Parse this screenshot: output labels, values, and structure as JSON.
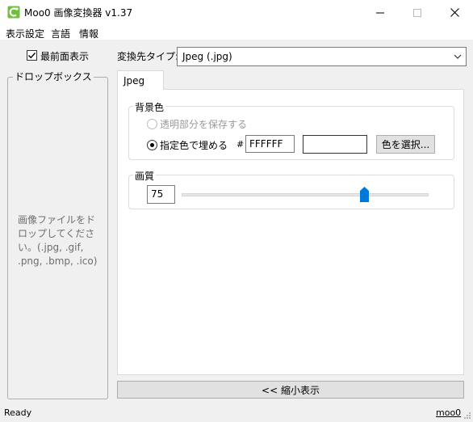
{
  "window": {
    "title": "Moo0 画像変換器 v1.37",
    "accent_color": "#6fbf3c"
  },
  "menu": {
    "items": [
      "表示設定",
      "言語",
      "情報"
    ]
  },
  "left_panel": {
    "always_on_top_label": "最前面表示",
    "always_on_top_checked": true,
    "dropbox_title": "ドロップボックス",
    "dropbox_hint": "画像ファイルをドロップしてください。(.jpg, .gif, .png, .bmp, .ico)"
  },
  "main": {
    "target_type_label": "変換先タイプ:",
    "target_type_value": "Jpeg (.jpg)",
    "tab_label": "Jpeg",
    "background": {
      "title": "背景色",
      "option_keep_transparent": "透明部分を保存する",
      "option_fill_color": "指定色で埋める",
      "hash_label": "#",
      "color_hex_value": "FFFFFF",
      "swatch_color": "#ffffff",
      "choose_color_button": "色を選択..."
    },
    "quality": {
      "title": "画質",
      "value": "75",
      "slider_fraction": 0.75,
      "thumb_color": "#0078d7"
    },
    "collapse_button": "<< 縮小表示"
  },
  "status_bar": {
    "status": "Ready",
    "link": "moo0"
  },
  "icons": {
    "app": "app-icon",
    "minimize": "minimize-icon",
    "maximize": "maximize-icon",
    "close": "close-icon",
    "dropdown": "chevron-down-icon",
    "grip": "resize-grip-icon"
  }
}
